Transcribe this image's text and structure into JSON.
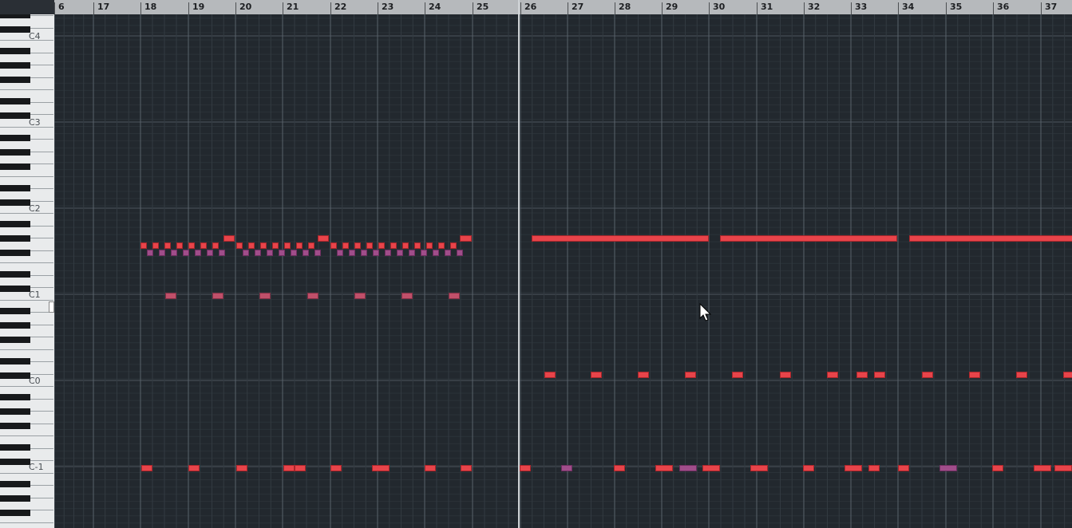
{
  "bars": [
    "6",
    "17",
    "18",
    "19",
    "20",
    "21",
    "22",
    "23",
    "24",
    "25",
    "26",
    "27",
    "28",
    "29",
    "30",
    "31",
    "32",
    "33",
    "34",
    "35",
    "36",
    "37"
  ],
  "octaves": [
    "C4",
    "C3",
    "C2",
    "C1",
    "C0",
    "C-1"
  ],
  "colors": {
    "note": "#e8444a",
    "note_velocity_alt": "#a04d8a",
    "note_pitch_alt": "#c0506a",
    "grid_bg": "#22282e",
    "ruler_bg": "#b6b9bc"
  },
  "cursor_icon": "arrow-pointer-icon"
}
